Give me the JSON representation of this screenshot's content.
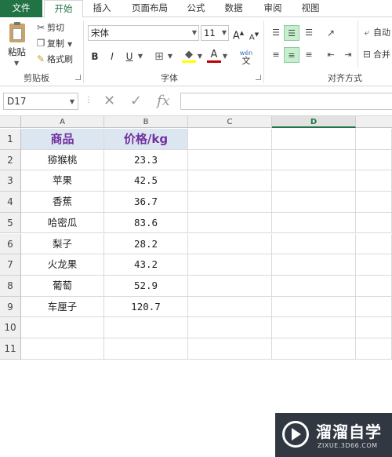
{
  "tabs": [
    {
      "label": "文件"
    },
    {
      "label": "开始"
    },
    {
      "label": "插入"
    },
    {
      "label": "页面布局"
    },
    {
      "label": "公式"
    },
    {
      "label": "数据"
    },
    {
      "label": "审阅"
    },
    {
      "label": "视图"
    }
  ],
  "clipboard": {
    "paste": "粘贴",
    "cut": "剪切",
    "copy": "复制",
    "format_painter": "格式刷",
    "group_label": "剪贴板"
  },
  "font": {
    "name": "宋体",
    "size": "11",
    "bold": "B",
    "italic": "I",
    "underline": "U",
    "grow": "A",
    "shrink": "A",
    "font_color": "A",
    "wen": "wén",
    "wen_char": "文",
    "group_label": "字体"
  },
  "alignment": {
    "wrap": "自动",
    "merge": "合并",
    "group_label": "对齐方式"
  },
  "formula_bar": {
    "name_box": "D17",
    "fx": "fx",
    "formula": ""
  },
  "grid": {
    "columns": [
      "A",
      "B",
      "C",
      "D"
    ],
    "rows": [
      "1",
      "2",
      "3",
      "4",
      "5",
      "6",
      "7",
      "8",
      "9",
      "10",
      "11"
    ],
    "header": [
      "商品",
      "价格/kg"
    ],
    "data": [
      [
        "猕猴桃",
        "23.3"
      ],
      [
        "苹果",
        "42.5"
      ],
      [
        "香蕉",
        "36.7"
      ],
      [
        "哈密瓜",
        "83.6"
      ],
      [
        "梨子",
        "28.2"
      ],
      [
        "火龙果",
        "43.2"
      ],
      [
        "葡萄",
        "52.9"
      ],
      [
        "车厘子",
        "120.7"
      ]
    ]
  },
  "watermark": {
    "title": "溜溜自学",
    "url": "ZIXUE.3D66.COM"
  },
  "colors": {
    "accent": "#217346",
    "header_fill": "#dce6f1",
    "header_text": "#7030a0"
  }
}
